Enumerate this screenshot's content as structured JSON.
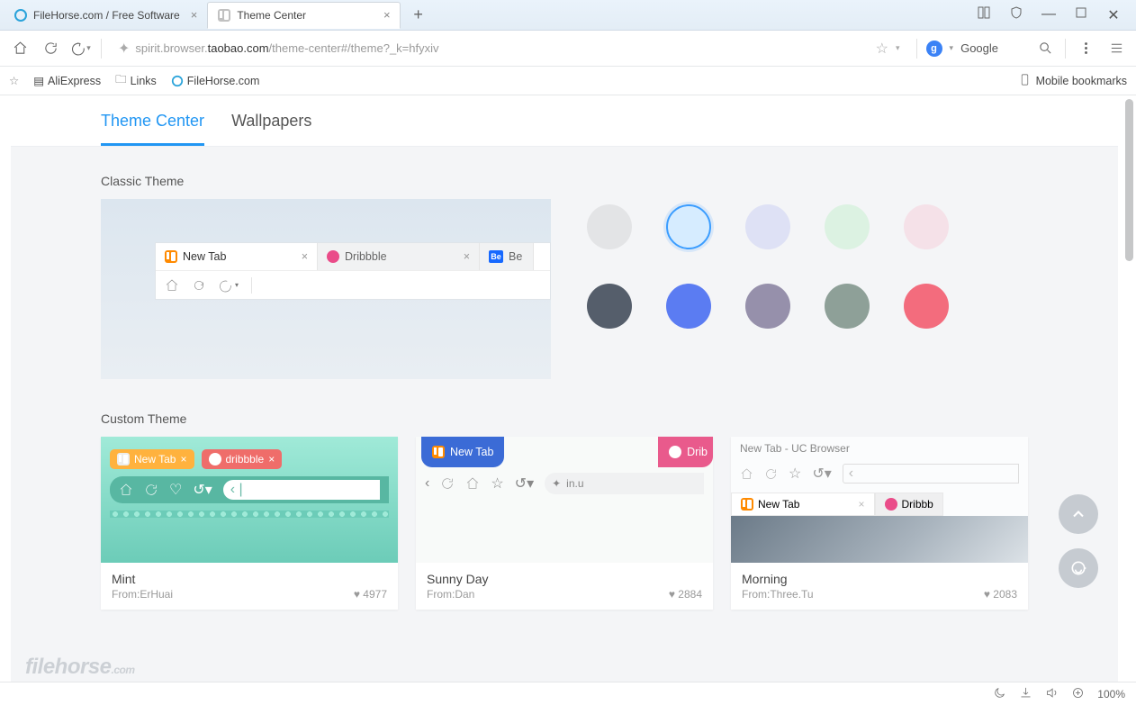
{
  "tabs": [
    {
      "title": "FileHorse.com / Free Software",
      "active": false
    },
    {
      "title": "Theme Center",
      "active": true
    }
  ],
  "toolbar": {
    "url_pre": "spirit.browser.",
    "url_bold": "taobao.com",
    "url_post": "/theme-center#/theme?_k=hfyxiv",
    "search_engine_label": "Google",
    "search_engine_badge": "g"
  },
  "bookmarks": {
    "items": [
      "AliExpress",
      "Links",
      "FileHorse.com"
    ],
    "right_label": "Mobile bookmarks"
  },
  "page_tabs": {
    "theme_center": "Theme Center",
    "wallpapers": "Wallpapers"
  },
  "sections": {
    "classic_title": "Classic Theme",
    "custom_title": "Custom Theme"
  },
  "classic_preview": {
    "tab1": "New Tab",
    "tab2": "Dribbble",
    "tab3": "Be"
  },
  "swatches": {
    "colors": [
      "#e3e4e6",
      "#d6ecff",
      "#dee1f5",
      "#dcf2e2",
      "#f5e1e8",
      "#555e6b",
      "#5b7cf2",
      "#9690ab",
      "#8ea098",
      "#f36c7d"
    ],
    "selected_index": 1
  },
  "custom_themes": [
    {
      "name": "Mint",
      "author_prefix": "From:",
      "author": "ErHuai",
      "likes": "4977",
      "thumb": {
        "tab1": "New Tab",
        "tab2": "dribbble"
      }
    },
    {
      "name": "Sunny Day",
      "author_prefix": "From:",
      "author": "Dan",
      "likes": "2884",
      "thumb": {
        "tab1": "New Tab",
        "tab2": "Drib",
        "url_stub": "in.u"
      }
    },
    {
      "name": "Morning",
      "author_prefix": "From:",
      "author": "Three.Tu",
      "likes": "2083",
      "thumb": {
        "title": "New Tab - UC Browser",
        "tab1": "New Tab",
        "tab2": "Dribbb"
      }
    }
  ],
  "status": {
    "zoom": "100%"
  },
  "watermark": {
    "brand": "filehorse",
    "tld": ".com"
  }
}
